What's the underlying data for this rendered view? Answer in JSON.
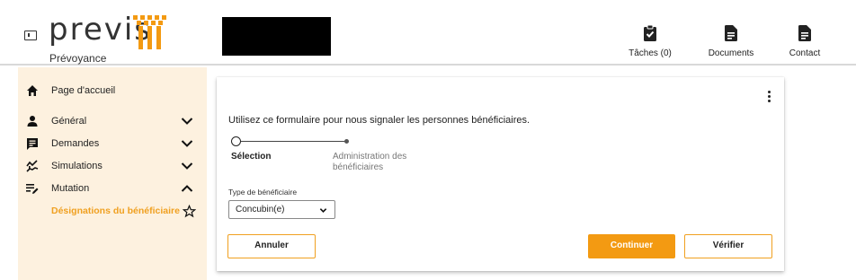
{
  "brand": {
    "name": "previs",
    "tagline": "Prévoyance",
    "accent": "#f39a12"
  },
  "header": {
    "actions": [
      {
        "label": "Tâches (0)",
        "icon": "clipboard-check-icon"
      },
      {
        "label": "Documents",
        "icon": "document-icon"
      },
      {
        "label": "Contact",
        "icon": "document-icon"
      }
    ]
  },
  "sidebar": {
    "home": {
      "label": "Page d'accueil",
      "icon": "home-icon"
    },
    "items": [
      {
        "label": "Général",
        "icon": "person-icon",
        "state": "collapsed"
      },
      {
        "label": "Demandes",
        "icon": "chat-list-icon",
        "state": "collapsed"
      },
      {
        "label": "Simulations",
        "icon": "chart-hand-icon",
        "state": "collapsed"
      },
      {
        "label": "Mutation",
        "icon": "edit-list-icon",
        "state": "expanded"
      }
    ],
    "active_sub": {
      "label": "Désignations du bénéficiaire",
      "icon": "star-icon"
    }
  },
  "form": {
    "intro": "Utilisez ce formulaire pour nous signaler les personnes bénéficiaires.",
    "steps": [
      {
        "label": "Sélection",
        "active": true
      },
      {
        "label": "Administration des bénéficiaires",
        "active": false
      }
    ],
    "beneficiary_type": {
      "label": "Type de bénéficiaire",
      "value": "Concubin(e)"
    },
    "buttons": {
      "cancel": "Annuler",
      "continue": "Continuer",
      "verify": "Vérifier"
    }
  }
}
